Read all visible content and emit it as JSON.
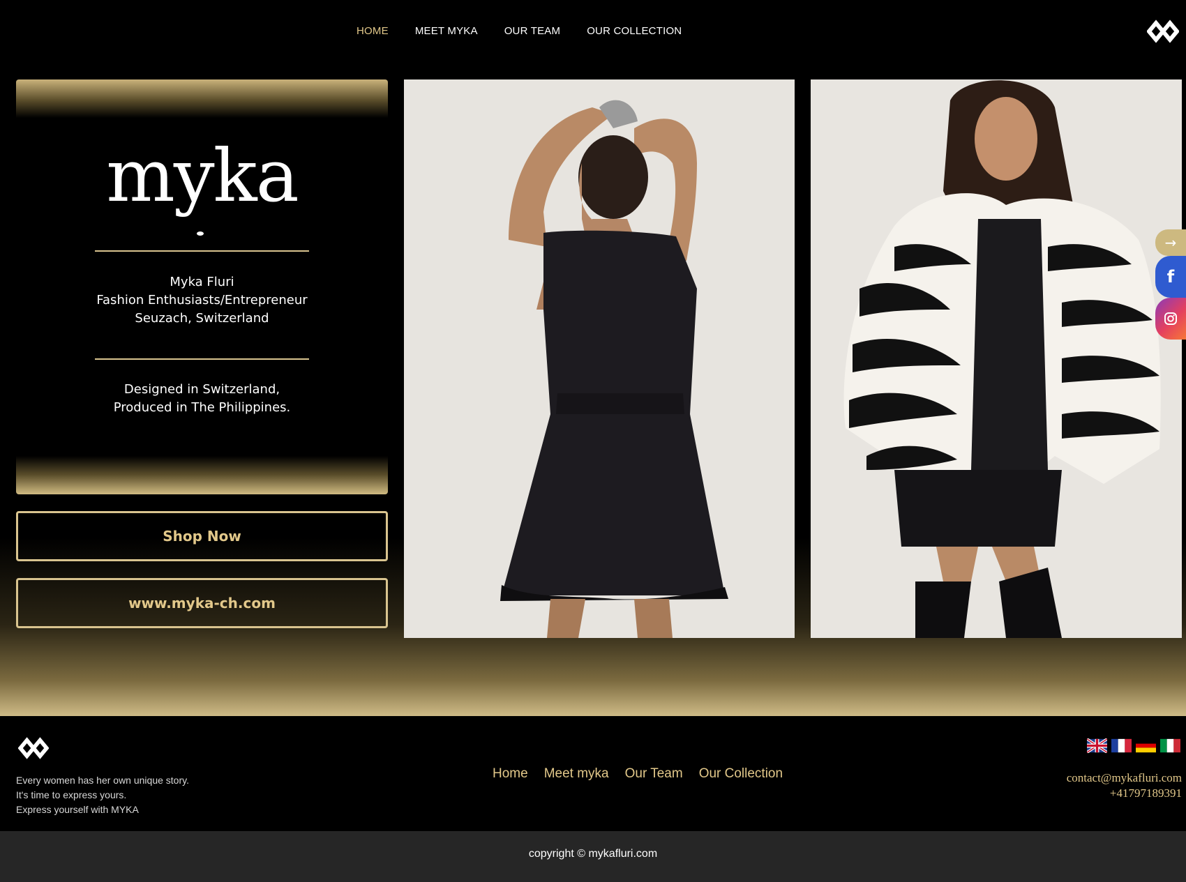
{
  "nav": {
    "items": [
      {
        "label": "HOME",
        "active": true
      },
      {
        "label": "MEET MYKA",
        "active": false
      },
      {
        "label": "OUR TEAM",
        "active": false
      },
      {
        "label": "OUR COLLECTION",
        "active": false
      }
    ],
    "brand_icon": "infinity-logo-icon"
  },
  "intro": {
    "logo_text": "myka",
    "name": "Myka Fluri",
    "role": "Fashion Enthusiasts/Entrepreneur",
    "location": "Seuzach, Switzerland",
    "origin_line1": "Designed in Switzerland,",
    "origin_line2": "Produced in The Philippines."
  },
  "buttons": {
    "shop": "Shop Now",
    "website": "www.myka-ch.com"
  },
  "side": {
    "arrow_icon": "→",
    "facebook_icon": "f",
    "instagram_icon": "instagram-icon"
  },
  "footer": {
    "tagline": [
      "Every women has her own unique story.",
      "It's time to express yours.",
      "Express yourself with MYKA"
    ],
    "links": [
      "Home",
      "Meet myka",
      "Our Team",
      "Our Collection"
    ],
    "flags": [
      "uk-flag-icon",
      "france-flag-icon",
      "germany-flag-icon",
      "italy-flag-icon"
    ],
    "email": "contact@mykafluri.com",
    "phone": "+41797189391",
    "copyright": "copyright © mykafluri.com"
  },
  "colors": {
    "accent_gold": "#e2c88a",
    "background": "#000000",
    "copyright_bar": "#262626"
  }
}
